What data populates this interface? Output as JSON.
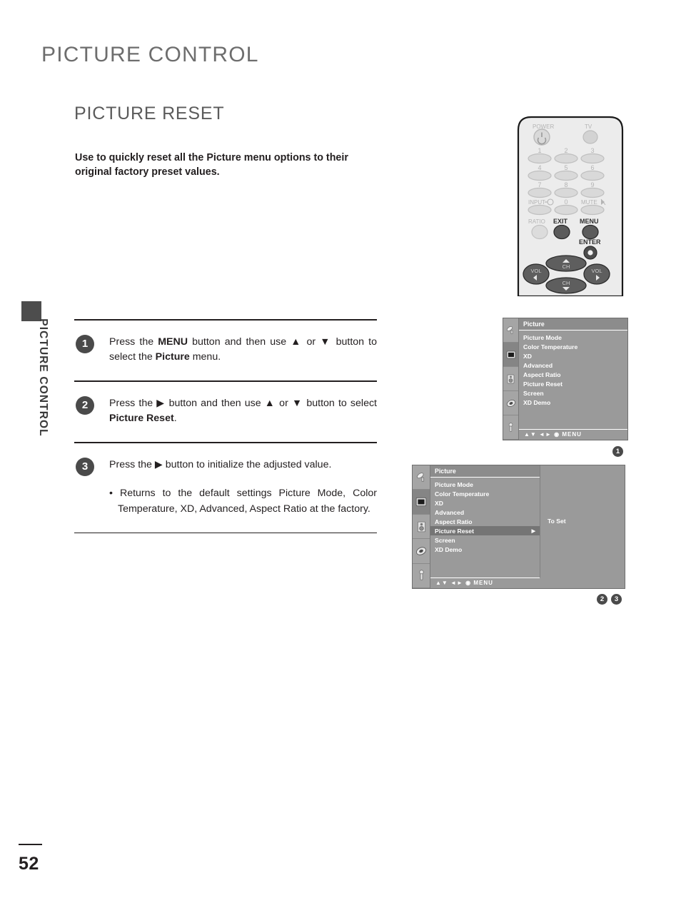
{
  "page": {
    "number": "52",
    "running_head": "PICTURE CONTROL",
    "chapter_title": "PICTURE CONTROL",
    "section_title": "PICTURE RESET",
    "intro": "Use to quickly reset all the Picture menu options to their original factory preset values."
  },
  "steps": [
    {
      "badge": "1",
      "html": "Press the <b>MENU</b> button and then use ▲ or ▼ button to select the <b>Picture</b> menu.",
      "bullet": ""
    },
    {
      "badge": "2",
      "html": "Press the ▶ button and then use ▲ or ▼ button to select <b>Picture Reset</b>.",
      "bullet": ""
    },
    {
      "badge": "3",
      "html": "Press the ▶ button to initialize the adjusted value.",
      "bullet": "• Returns to the default settings Picture Mode, Color Temperature, XD, Advanced, Aspect Ratio at the factory."
    }
  ],
  "remote": {
    "power_label": "POWER",
    "tv_label": "TV",
    "numbers": [
      "1",
      "2",
      "3",
      "4",
      "5",
      "6",
      "7",
      "8",
      "9"
    ],
    "input_label": "INPUT",
    "zero_label": "0",
    "mute_label": "MUTE",
    "ratio_label": "RATIO",
    "exit_label": "EXIT",
    "menu_label": "MENU",
    "enter_label": "ENTER",
    "vol_label": "VOL",
    "ch_label": "CH"
  },
  "osd": {
    "title": "Picture",
    "items": [
      "Picture Mode",
      "Color Temperature",
      "XD",
      "Advanced",
      "Aspect Ratio",
      "Picture Reset",
      "Screen",
      "XD Demo"
    ],
    "selected_item": "Picture Reset",
    "selected_arrow": "▶",
    "to_set_label": "To Set",
    "nav": "▲▼  ◄►   ◉   MENU",
    "icons": [
      "antenna-icon",
      "picture-icon",
      "audio-icon",
      "timer-icon",
      "lock-icon"
    ],
    "active_icon_index": 1
  },
  "markers": {
    "near_osd1": "1",
    "near_osd2_a": "2",
    "near_osd2_b": "3"
  },
  "colors": {
    "heading_gray": "#6d6d6d",
    "badge_dark": "#4a4a4a",
    "osd_bg": "#9a9a9a",
    "osd_selected": "#757575",
    "text": "#231f20"
  }
}
